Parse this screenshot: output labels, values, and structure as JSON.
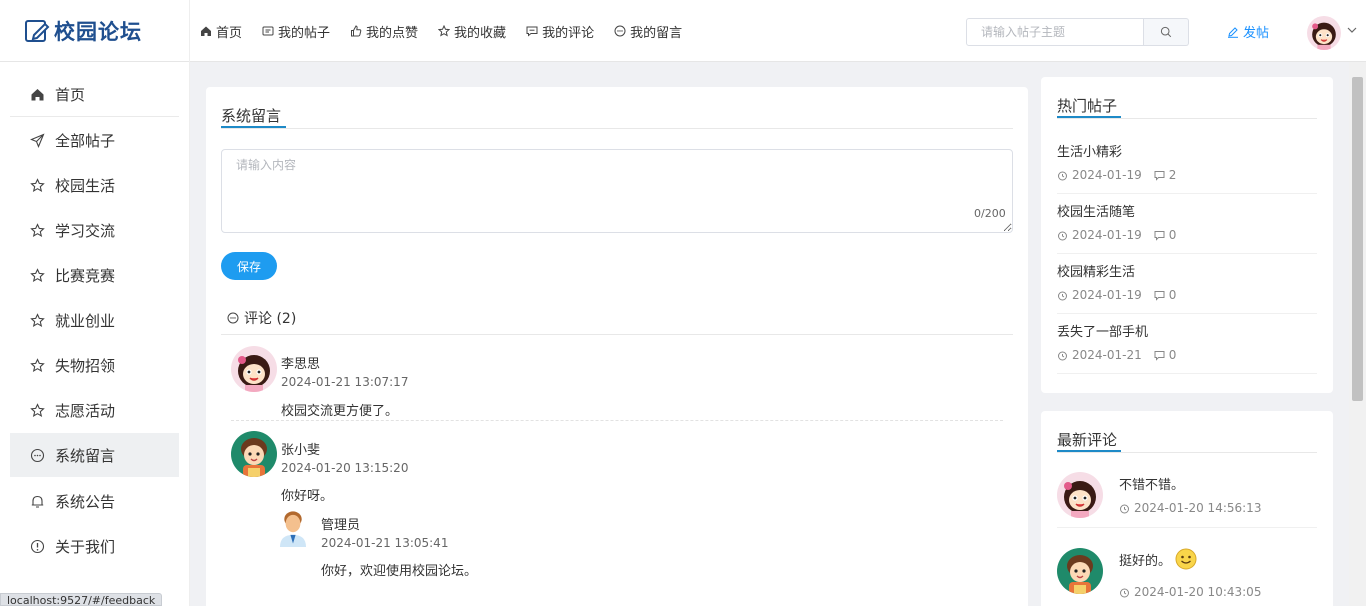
{
  "brand": {
    "name": "校园论坛",
    "accent": "#1f4f8f"
  },
  "topnav": [
    {
      "label": "首页",
      "icon": "home-icon"
    },
    {
      "label": "我的帖子",
      "icon": "message-box-icon"
    },
    {
      "label": "我的点赞",
      "icon": "thumb-up-icon"
    },
    {
      "label": "我的收藏",
      "icon": "star-icon"
    },
    {
      "label": "我的评论",
      "icon": "chat-icon"
    },
    {
      "label": "我的留言",
      "icon": "chat-dots-icon"
    }
  ],
  "search": {
    "placeholder": "请输入帖子主题"
  },
  "header_actions": {
    "post_label": "发帖"
  },
  "sidebar": {
    "items": [
      {
        "label": "首页",
        "icon": "home-icon"
      },
      {
        "label": "全部帖子",
        "icon": "send-icon"
      },
      {
        "label": "校园生活",
        "icon": "star-icon"
      },
      {
        "label": "学习交流",
        "icon": "star-icon"
      },
      {
        "label": "比赛竞赛",
        "icon": "star-icon"
      },
      {
        "label": "就业创业",
        "icon": "star-icon"
      },
      {
        "label": "失物招领",
        "icon": "star-icon"
      },
      {
        "label": "志愿活动",
        "icon": "star-icon"
      },
      {
        "label": "系统留言",
        "icon": "chat-dots-icon",
        "active": true
      },
      {
        "label": "系统公告",
        "icon": "bell-icon"
      },
      {
        "label": "关于我们",
        "icon": "info-icon"
      }
    ]
  },
  "feedback": {
    "title": "系统留言",
    "textarea_placeholder": "请输入内容",
    "counter": "0/200",
    "save_label": "保存",
    "comments_label": "评论 (2)",
    "comments": [
      {
        "name": "李思思",
        "time": "2024-01-21 13:07:17",
        "text": "校园交流更方便了。",
        "avatar": "girl-avatar"
      },
      {
        "name": "张小斐",
        "time": "2024-01-20 13:15:20",
        "text": "你好呀。",
        "avatar": "girl-green-avatar",
        "reply": {
          "name": "管理员",
          "time": "2024-01-21 13:05:41",
          "text": "你好，欢迎使用校园论坛。",
          "avatar": "admin-avatar"
        }
      }
    ]
  },
  "hot_posts": {
    "title": "热门帖子",
    "items": [
      {
        "title": "生活小精彩",
        "date": "2024-01-19",
        "comments": "2"
      },
      {
        "title": "校园生活随笔",
        "date": "2024-01-19",
        "comments": "0"
      },
      {
        "title": "校园精彩生活",
        "date": "2024-01-19",
        "comments": "0"
      },
      {
        "title": "丢失了一部手机",
        "date": "2024-01-21",
        "comments": "0"
      }
    ]
  },
  "latest_comments": {
    "title": "最新评论",
    "items": [
      {
        "text": "不错不错。",
        "time": "2024-01-20 14:56:13",
        "avatar": "girl-avatar"
      },
      {
        "text": "挺好的。",
        "time": "2024-01-20 10:43:05",
        "avatar": "girl-green-avatar",
        "emoji": "smile-emoji-icon"
      }
    ]
  },
  "status_url": "localhost:9527/#/feedback"
}
